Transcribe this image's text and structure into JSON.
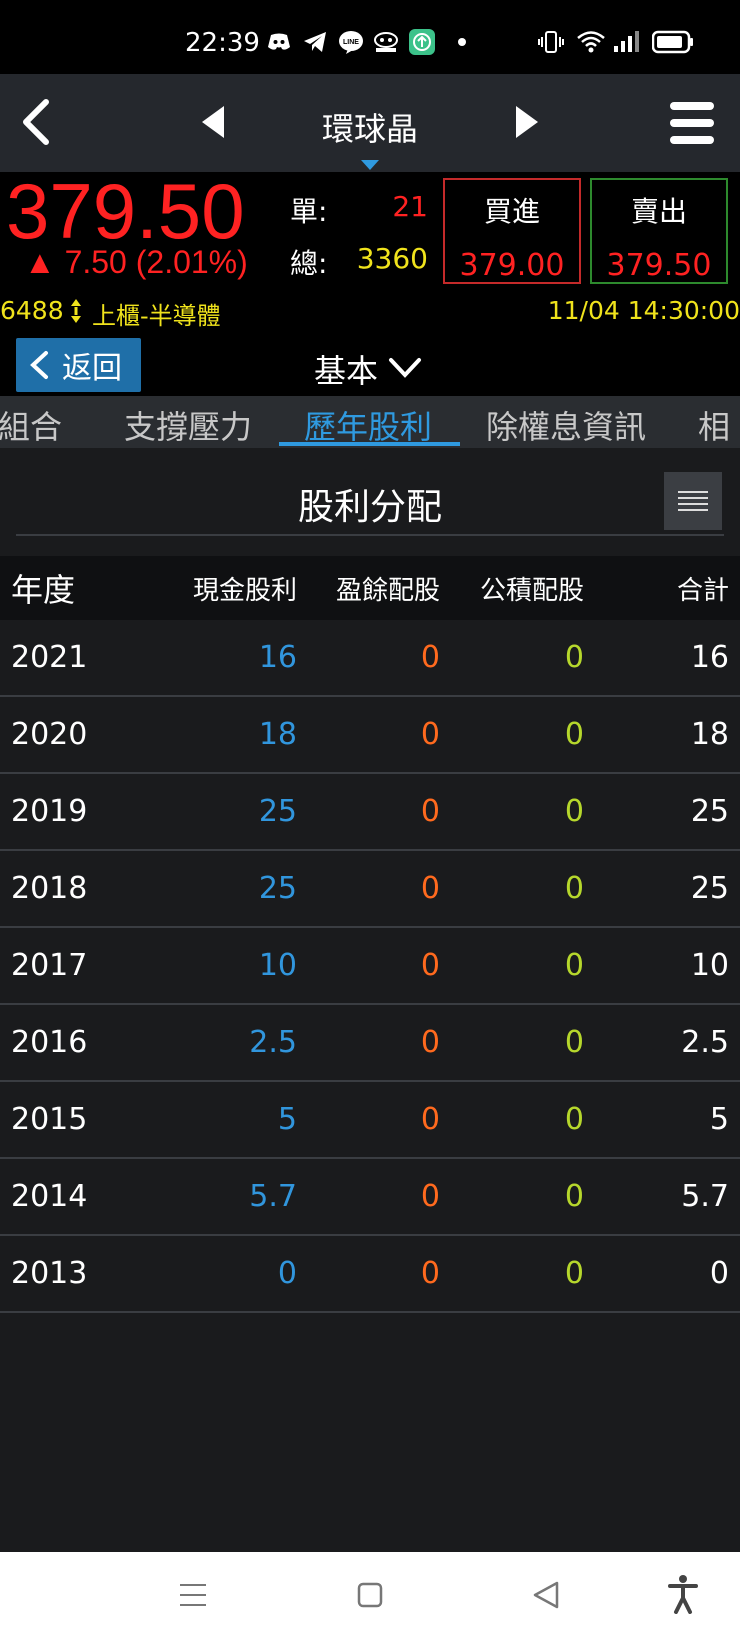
{
  "status_bar": {
    "time": "22:39"
  },
  "header": {
    "title": "環球晶"
  },
  "quote": {
    "price": "379.50",
    "change": "▲ 7.50 (2.01%)",
    "single_label": "單:",
    "single_value": "21",
    "total_label": "總:",
    "total_value": "3360",
    "buy_label": "買進",
    "buy_price": "379.00",
    "sell_label": "賣出",
    "sell_price": "379.50",
    "code": "6488",
    "market": "上櫃-半導體",
    "datetime": "11/04 14:30:00"
  },
  "controls": {
    "back_label": "返回",
    "category": "基本"
  },
  "tabs": [
    {
      "label": "組合"
    },
    {
      "label": "支撐壓力"
    },
    {
      "label": "歷年股利"
    },
    {
      "label": "除權息資訊"
    },
    {
      "label": "相"
    }
  ],
  "section": {
    "title": "股利分配"
  },
  "table": {
    "headers": {
      "year": "年度",
      "cash": "現金股利",
      "stock": "盈餘配股",
      "reserve": "公積配股",
      "total": "合計"
    },
    "rows": [
      {
        "year": "2021",
        "cash": "16",
        "stock": "0",
        "reserve": "0",
        "total": "16"
      },
      {
        "year": "2020",
        "cash": "18",
        "stock": "0",
        "reserve": "0",
        "total": "18"
      },
      {
        "year": "2019",
        "cash": "25",
        "stock": "0",
        "reserve": "0",
        "total": "25"
      },
      {
        "year": "2018",
        "cash": "25",
        "stock": "0",
        "reserve": "0",
        "total": "25"
      },
      {
        "year": "2017",
        "cash": "10",
        "stock": "0",
        "reserve": "0",
        "total": "10"
      },
      {
        "year": "2016",
        "cash": "2.5",
        "stock": "0",
        "reserve": "0",
        "total": "2.5"
      },
      {
        "year": "2015",
        "cash": "5",
        "stock": "0",
        "reserve": "0",
        "total": "5"
      },
      {
        "year": "2014",
        "cash": "5.7",
        "stock": "0",
        "reserve": "0",
        "total": "5.7"
      },
      {
        "year": "2013",
        "cash": "0",
        "stock": "0",
        "reserve": "0",
        "total": "0"
      }
    ]
  },
  "colors": {
    "up_red": "#ff2222",
    "yellow": "#f0e31c",
    "accent_blue": "#2f9ae0",
    "cash_blue": "#3196dd",
    "stock_orange": "#ff6a1e",
    "reserve_green": "#b6d72c"
  },
  "icons": {
    "status": [
      "discord-icon",
      "telegram-icon",
      "line-icon",
      "gomaji-icon",
      "upload-app-icon",
      "dot-icon",
      "vibrate-icon",
      "wifi-icon",
      "signal-icon",
      "battery-icon"
    ],
    "nav": [
      "back-arrow-icon",
      "prev-triangle-icon",
      "next-triangle-icon",
      "hamburger-menu-icon"
    ],
    "bottom": [
      "recents-icon",
      "home-icon",
      "back-icon",
      "accessibility-icon"
    ]
  }
}
